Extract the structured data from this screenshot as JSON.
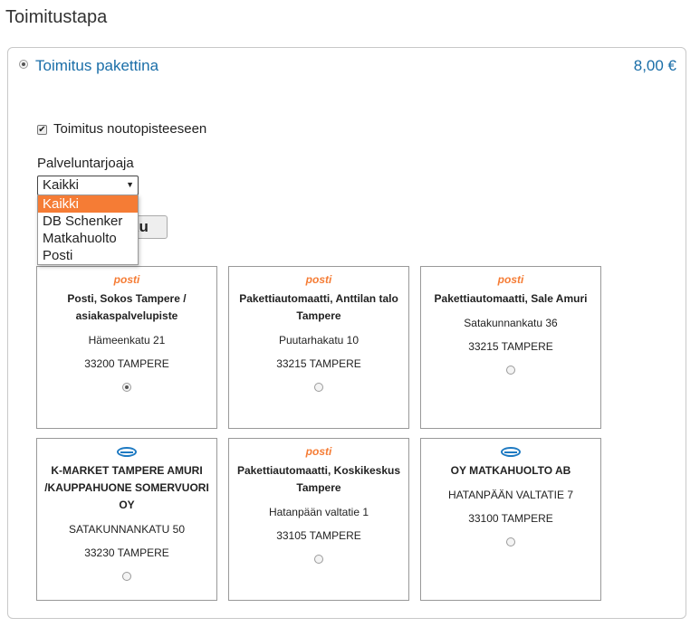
{
  "page_title": "Toimitustapa",
  "method": {
    "label": "Toimitus pakettina",
    "price": "8,00 €",
    "selected": true
  },
  "pickup": {
    "checkbox_label": "Toimitus noutopisteeseen",
    "checked": true
  },
  "provider": {
    "label": "Palveluntarjoaja",
    "selected": "Kaikki",
    "options": [
      "Kaikki",
      "DB Schenker",
      "Matkahuolto",
      "Posti"
    ]
  },
  "search_button_partial": "ku",
  "icons": {
    "posti": "posti",
    "matkahuolto": "matkahuolto-logo-icon"
  },
  "colors": {
    "accent": "#1a6ea8",
    "posti": "#f57c35",
    "matkahuolto": "#1e7ac2"
  },
  "points": [
    {
      "logo": "posti",
      "name": "Posti, Sokos Tampere / asiakaspalvelupiste",
      "street": "Hämeenkatu 21",
      "city": "33200 TAMPERE",
      "selected": true
    },
    {
      "logo": "posti",
      "name": "Pakettiautomaatti, Anttilan talo Tampere",
      "street": "Puutarhakatu 10",
      "city": "33215 TAMPERE",
      "selected": false
    },
    {
      "logo": "posti",
      "name": "Pakettiautomaatti, Sale Amuri",
      "street": "Satakunnankatu 36",
      "city": "33215 TAMPERE",
      "selected": false
    },
    {
      "logo": "matkahuolto",
      "name": "K-MARKET TAMPERE AMURI /KAUPPAHUONE SOMERVUORI OY",
      "street": "SATAKUNNANKATU 50",
      "city": "33230 TAMPERE",
      "selected": false
    },
    {
      "logo": "posti",
      "name": "Pakettiautomaatti, Koskikeskus Tampere",
      "street": "Hatanpään valtatie 1",
      "city": "33105 TAMPERE",
      "selected": false
    },
    {
      "logo": "matkahuolto",
      "name": "OY MATKAHUOLTO AB",
      "street": "HATANPÄÄN VALTATIE 7",
      "city": "33100 TAMPERE",
      "selected": false
    }
  ]
}
